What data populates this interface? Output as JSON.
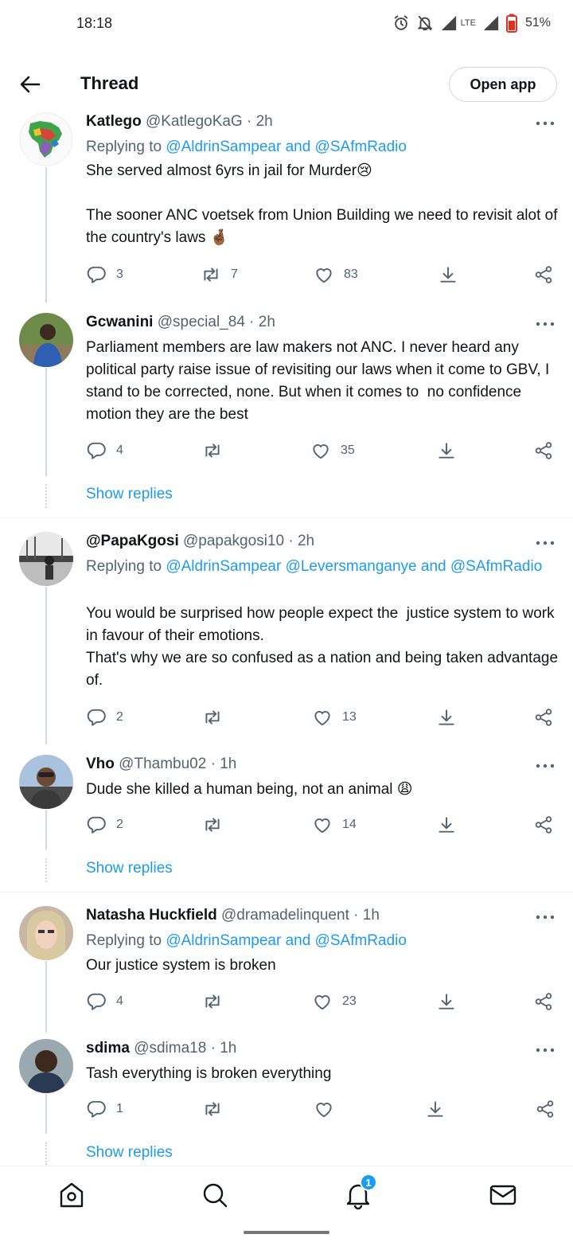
{
  "status_bar": {
    "time": "18:18",
    "network": "LTE",
    "battery": "51%"
  },
  "header": {
    "title": "Thread",
    "open_app": "Open app"
  },
  "tweets": [
    {
      "name": "Katlego",
      "handle": "@KatlegoKaG",
      "time": "2h",
      "reply_prefix": "Replying to",
      "reply_to": "@AldrinSampear and @SAfmRadio",
      "text": "She served almost 6yrs in jail for Murder😢\n\nThe sooner ANC voetsek from Union Building we need to revisit alot of the country's laws 🤞🏾",
      "replies": "3",
      "retweets": "7",
      "likes": "83"
    },
    {
      "name": "Gcwanini",
      "handle": "@special_84",
      "time": "2h",
      "text": "Parliament members are law makers not ANC. I never heard any political party raise issue of revisiting our laws when it come to GBV, I stand to be corrected, none. But when it comes to  no confidence motion they are the best",
      "replies": "4",
      "retweets": "",
      "likes": "35",
      "show_replies": "Show replies"
    },
    {
      "name": "@PapaKgosi",
      "handle": "@papakgosi10",
      "time": "2h",
      "reply_prefix": "Replying to",
      "reply_to": "@AldrinSampear @Leversmanganye and @SAfmRadio",
      "text": "You would be surprised how people expect the  justice system to work in favour of their emotions.\nThat's why we are so confused as a nation and being taken advantage of.",
      "replies": "2",
      "retweets": "",
      "likes": "13"
    },
    {
      "name": "Vho",
      "handle": "@Thambu02",
      "time": "1h",
      "text": "Dude she killed a human being, not an animal 😩",
      "replies": "2",
      "retweets": "",
      "likes": "14",
      "show_replies": "Show replies"
    },
    {
      "name": "Natasha Huckfield",
      "handle": "@dramadelinquent",
      "time": "1h",
      "reply_prefix": "Replying to",
      "reply_to": "@AldrinSampear and @SAfmRadio",
      "text": "Our justice system is broken",
      "replies": "4",
      "retweets": "",
      "likes": "23"
    },
    {
      "name": "sdima",
      "handle": "@sdima18",
      "time": "1h",
      "text": "Tash everything is broken everything",
      "replies": "1",
      "retweets": "",
      "likes": "",
      "show_replies": "Show replies"
    }
  ],
  "bottom_nav": {
    "notifications_badge": "1"
  },
  "colors": {
    "link": "#1d9bf0",
    "secondary_text": "#536471",
    "primary_text": "#0f1419"
  }
}
